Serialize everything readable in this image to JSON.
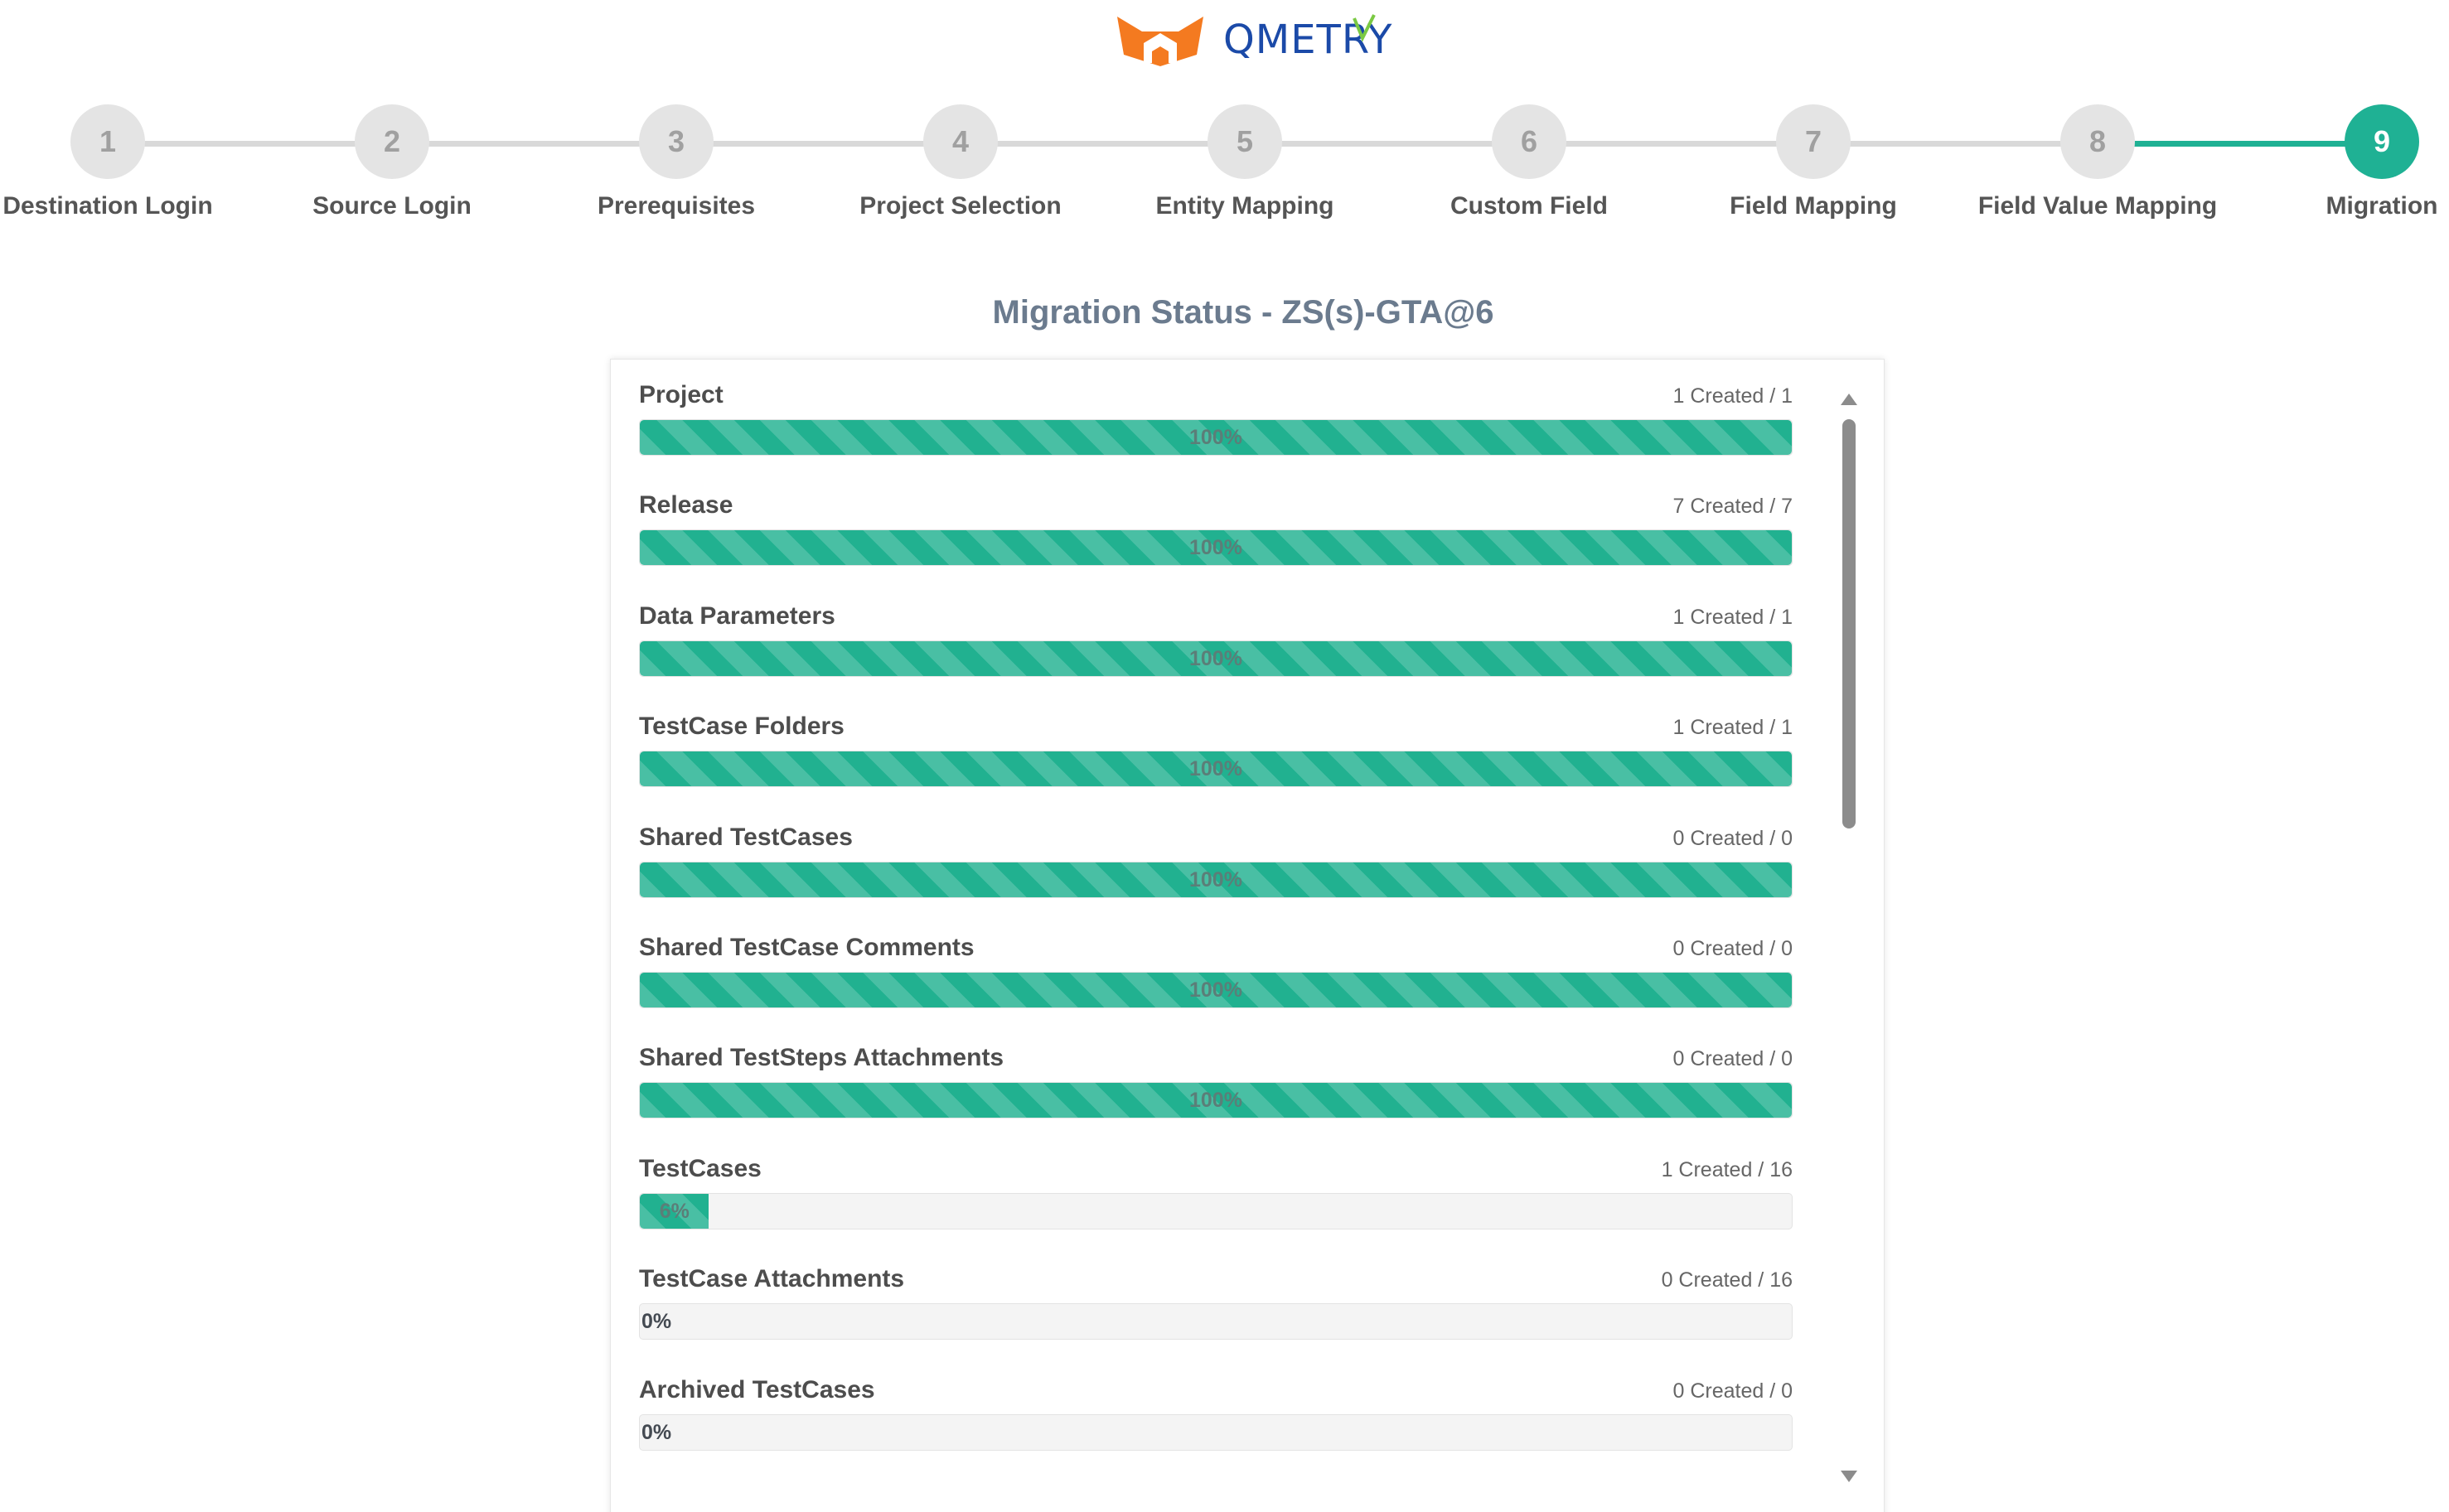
{
  "brand": {
    "name": "QMETRY",
    "colors": {
      "orange": "#f47a20",
      "blue": "#1b4aa8",
      "green": "#7ac943"
    }
  },
  "accent_color": "#1fb194",
  "steps": [
    {
      "number": "1",
      "label": "Destination Login",
      "active": false
    },
    {
      "number": "2",
      "label": "Source Login",
      "active": false
    },
    {
      "number": "3",
      "label": "Prerequisites",
      "active": false
    },
    {
      "number": "4",
      "label": "Project Selection",
      "active": false
    },
    {
      "number": "5",
      "label": "Entity Mapping",
      "active": false
    },
    {
      "number": "6",
      "label": "Custom Field",
      "active": false
    },
    {
      "number": "7",
      "label": "Field Mapping",
      "active": false
    },
    {
      "number": "8",
      "label": "Field Value Mapping",
      "active": false
    },
    {
      "number": "9",
      "label": "Migration",
      "active": true
    }
  ],
  "status_title": "Migration Status - ZS(s)-GTA@6",
  "entities": [
    {
      "name": "Project",
      "count": "1 Created / 1",
      "progress": 100,
      "label": "100%"
    },
    {
      "name": "Release",
      "count": "7 Created / 7",
      "progress": 100,
      "label": "100%"
    },
    {
      "name": "Data Parameters",
      "count": "1 Created / 1",
      "progress": 100,
      "label": "100%"
    },
    {
      "name": "TestCase Folders",
      "count": "1 Created / 1",
      "progress": 100,
      "label": "100%"
    },
    {
      "name": "Shared TestCases",
      "count": "0 Created / 0",
      "progress": 100,
      "label": "100%"
    },
    {
      "name": "Shared TestCase Comments",
      "count": "0 Created / 0",
      "progress": 100,
      "label": "100%"
    },
    {
      "name": "Shared TestSteps Attachments",
      "count": "0 Created / 0",
      "progress": 100,
      "label": "100%"
    },
    {
      "name": "TestCases",
      "count": "1 Created / 16",
      "progress": 6,
      "label": "6%"
    },
    {
      "name": "TestCase Attachments",
      "count": "0 Created / 16",
      "progress": 0,
      "label": "0%"
    },
    {
      "name": "Archived TestCases",
      "count": "0 Created / 0",
      "progress": 0,
      "label": "0%"
    }
  ],
  "scrollbar": {
    "up_icon": "triangle-up-icon",
    "down_icon": "triangle-down-icon"
  }
}
